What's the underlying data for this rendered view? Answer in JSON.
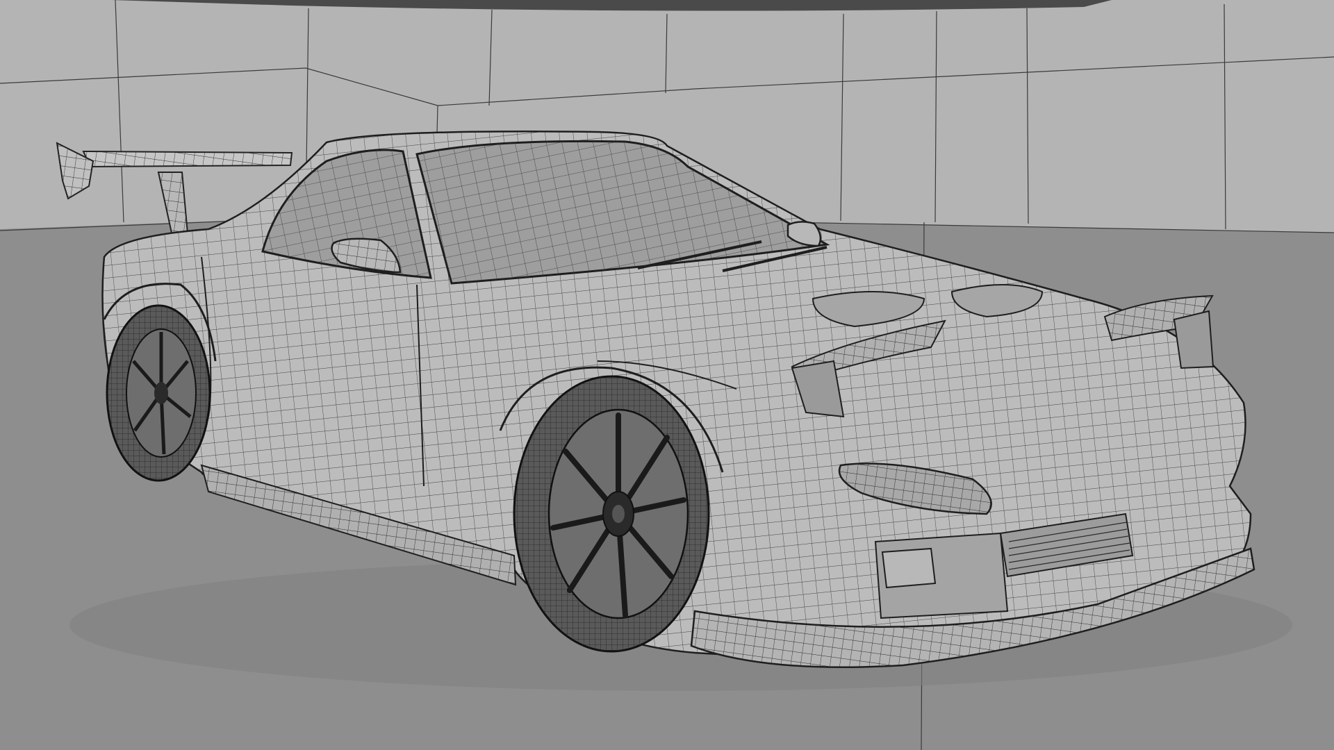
{
  "scene": {
    "subject": "sports-car-wireframe-model",
    "view": "3d-viewport-perspective",
    "colors": {
      "wall": "#b4b4b4",
      "floor": "#8e8e8e",
      "ceiling_strip": "#4a4a4a",
      "wall_grid_line": "#3a3a3a",
      "car_surface": "#bcbcbc",
      "car_shadow": "#9a9a9a",
      "wire": "#2a2a2a",
      "glass": "#9e9e9e",
      "tire": "#5a5a5a",
      "wheel_rim": "#6e6e6e"
    }
  }
}
